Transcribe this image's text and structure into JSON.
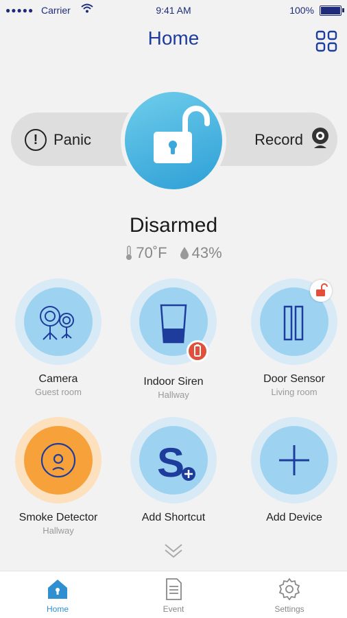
{
  "status_bar": {
    "signal_dots": "●●●●●",
    "carrier": "Carrier",
    "time": "9:41 AM",
    "battery": "100%"
  },
  "header": {
    "title": "Home"
  },
  "controls": {
    "panic_label": "Panic",
    "record_label": "Record"
  },
  "security": {
    "state": "Disarmed",
    "temperature": "70˚F",
    "humidity": "43%"
  },
  "devices": [
    {
      "name": "Camera",
      "room": "Guest room"
    },
    {
      "name": "Indoor Siren",
      "room": "Hallway"
    },
    {
      "name": "Door Sensor",
      "room": "Living room"
    },
    {
      "name": "Smoke Detector",
      "room": "Hallway"
    },
    {
      "name": "Add Shortcut",
      "room": ""
    },
    {
      "name": "Add Device",
      "room": ""
    }
  ],
  "tabs": [
    {
      "label": "Home"
    },
    {
      "label": "Event"
    },
    {
      "label": "Settings"
    }
  ],
  "colors": {
    "accent": "#1d3c9b",
    "lock_gradient_start": "#6fcdeb",
    "lock_gradient_end": "#2d9fd6",
    "device_circle": "#9dd3f1",
    "smoke_orange": "#f7a13a",
    "alert_red": "#e0503a"
  }
}
